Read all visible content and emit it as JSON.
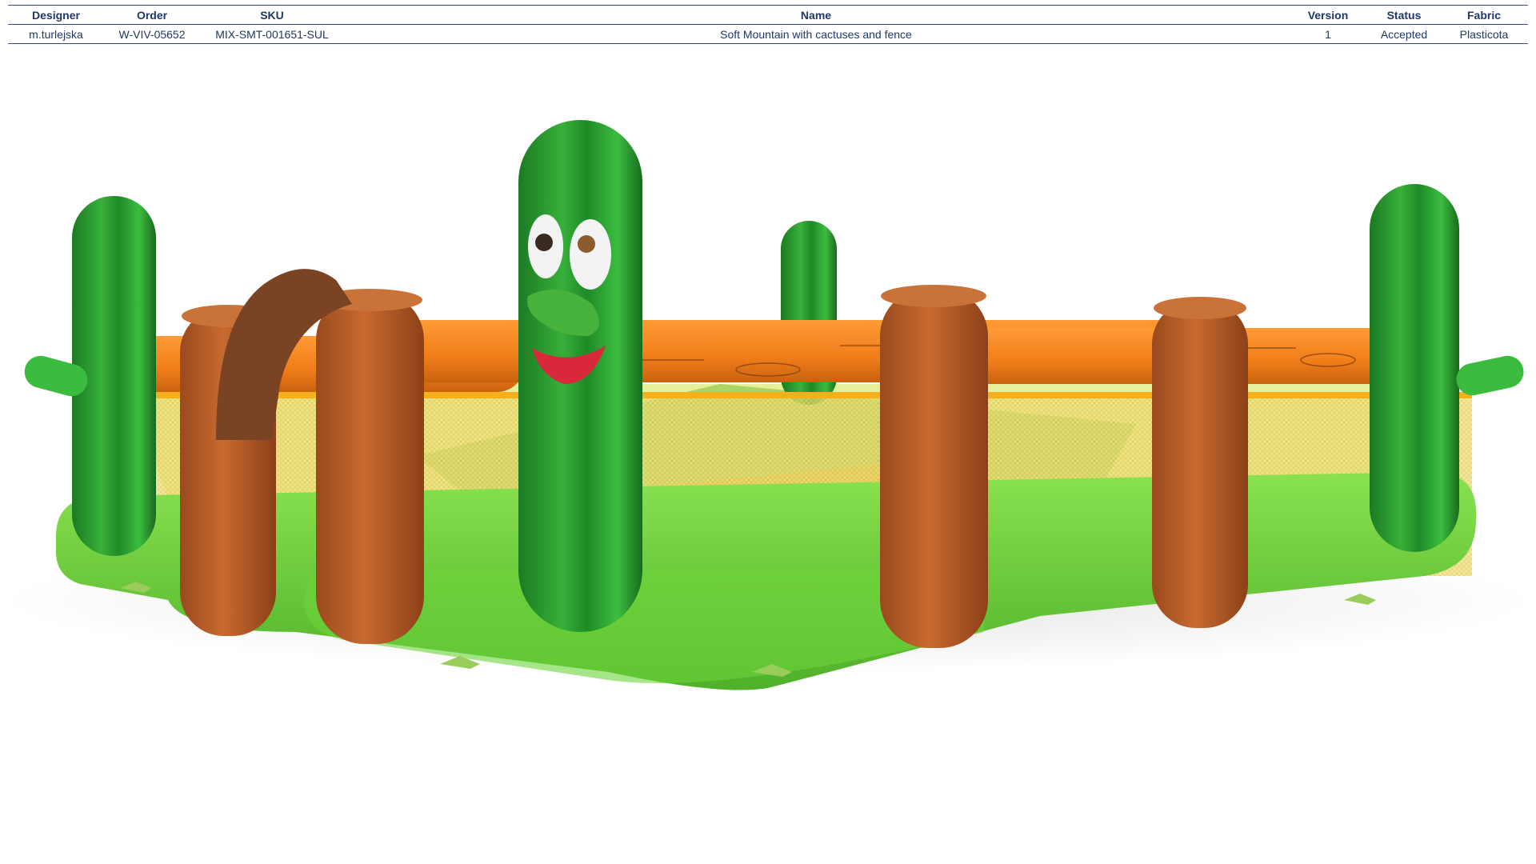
{
  "spec_table": {
    "headers": {
      "designer": "Designer",
      "order": "Order",
      "sku": "SKU",
      "name": "Name",
      "version": "Version",
      "status": "Status",
      "fabric": "Fabric"
    },
    "row": {
      "designer": "m.turlejska",
      "order": "W-VIV-05652",
      "sku": "MIX-SMT-001651-SUL",
      "name": "Soft Mountain with cactuses and fence",
      "version": "1",
      "status": "Accepted",
      "fabric": "Plasticota"
    }
  },
  "colors": {
    "table_text": "#1f3864",
    "table_rule": "#2e4a7a",
    "cactus_green": "#2fa52f",
    "cactus_dark": "#1b7a22",
    "base_green": "#6cd33a",
    "log_orange": "#f07d1a",
    "post_brown": "#b85e2a",
    "arch_brown": "#7a4324",
    "net_yellow": "#f0d54a"
  }
}
